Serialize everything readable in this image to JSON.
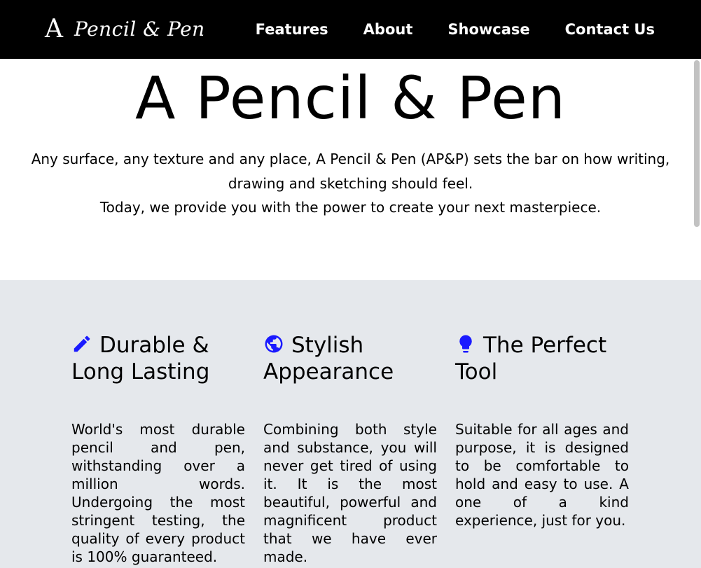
{
  "brand": {
    "mark": "A",
    "name": "Pencil & Pen"
  },
  "nav": {
    "items": [
      {
        "label": "Features"
      },
      {
        "label": "About"
      },
      {
        "label": "Showcase"
      },
      {
        "label": "Contact Us"
      }
    ]
  },
  "hero": {
    "title": "A Pencil & Pen",
    "line1": "Any surface, any texture and any place, A Pencil & Pen (AP&P) sets the bar on how writing, drawing and sketching should feel.",
    "line2": "Today, we provide you with the power to create your next masterpiece."
  },
  "features": [
    {
      "icon": "pencil-icon",
      "title": "Durable & Long Lasting",
      "body": "World's most durable pencil and pen, withstanding over a million words. Undergoing the most stringent testing, the quality of every product is 100% guaranteed."
    },
    {
      "icon": "globe-icon",
      "title": "Stylish Appearance",
      "body": "Combining both style and substance, you will never get tired of using it. It is the most beautiful, powerful and magnificent product that we have ever made."
    },
    {
      "icon": "lightbulb-icon",
      "title": "The Perfect Tool",
      "body": "Suitable for all ages and purpose, it is designed to be comfortable to hold and easy to use. A one of a kind experience, just for you."
    }
  ],
  "colors": {
    "header_bg": "#000000",
    "features_bg": "#e5e8ec",
    "icon_blue": "#1a1aff"
  }
}
